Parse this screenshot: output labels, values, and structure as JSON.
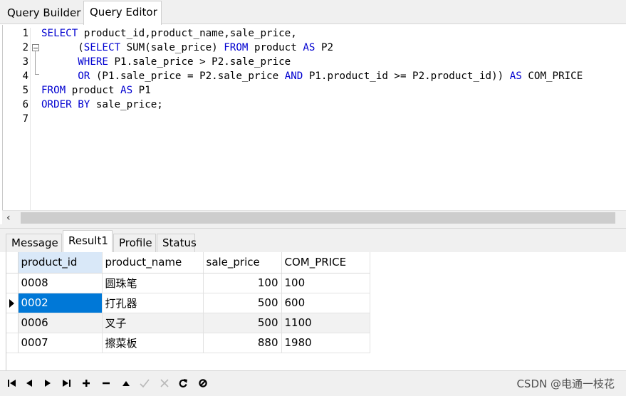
{
  "top_tabs": {
    "query_builder": "Query Builder",
    "query_editor": "Query Editor"
  },
  "editor": {
    "line_numbers": [
      "1",
      "2",
      "3",
      "4",
      "5",
      "6",
      "7"
    ],
    "lines": [
      [
        {
          "t": "SELECT",
          "k": true
        },
        {
          "t": " product_id,product_name,sale_price,",
          "k": false
        }
      ],
      [
        {
          "t": "      (",
          "k": false
        },
        {
          "t": "SELECT",
          "k": true
        },
        {
          "t": " SUM(sale_price) ",
          "k": false
        },
        {
          "t": "FROM",
          "k": true
        },
        {
          "t": " product ",
          "k": false
        },
        {
          "t": "AS",
          "k": true
        },
        {
          "t": " P2",
          "k": false
        }
      ],
      [
        {
          "t": "      ",
          "k": false
        },
        {
          "t": "WHERE",
          "k": true
        },
        {
          "t": " P1.sale_price > P2.sale_price",
          "k": false
        }
      ],
      [
        {
          "t": "      ",
          "k": false
        },
        {
          "t": "OR",
          "k": true
        },
        {
          "t": " (P1.sale_price = P2.sale_price ",
          "k": false
        },
        {
          "t": "AND",
          "k": true
        },
        {
          "t": " P1.product_id >= P2.product_id)) ",
          "k": false
        },
        {
          "t": "AS",
          "k": true
        },
        {
          "t": " COM_PRICE",
          "k": false
        }
      ],
      [
        {
          "t": "FROM",
          "k": true
        },
        {
          "t": " product ",
          "k": false
        },
        {
          "t": "AS",
          "k": true
        },
        {
          "t": " P1",
          "k": false
        }
      ],
      [
        {
          "t": "ORDER BY",
          "k": true
        },
        {
          "t": " sale_price;",
          "k": false
        }
      ],
      []
    ]
  },
  "result_tabs": {
    "message": "Message",
    "result1": "Result1",
    "profile": "Profile",
    "status": "Status"
  },
  "grid": {
    "columns": [
      "product_id",
      "product_name",
      "sale_price",
      "COM_PRICE"
    ],
    "rows": [
      [
        "0008",
        "圆珠笔",
        "100",
        "100"
      ],
      [
        "0002",
        "打孔器",
        "500",
        "600"
      ],
      [
        "0006",
        "叉子",
        "500",
        "1100"
      ],
      [
        "0007",
        "擦菜板",
        "880",
        "1980"
      ]
    ],
    "current_row": 1
  },
  "nav_toolbar": {
    "buttons": [
      "first-record",
      "prior-record",
      "next-record",
      "last-record",
      "insert-record",
      "delete-record",
      "edit-record",
      "post-edit",
      "cancel-edit",
      "refresh",
      "stop"
    ]
  },
  "watermark": "CSDN @电通一枝花",
  "colors": {
    "keyword": "#0000d0",
    "selection": "#0078d7",
    "active_header": "#d9e8f8"
  }
}
